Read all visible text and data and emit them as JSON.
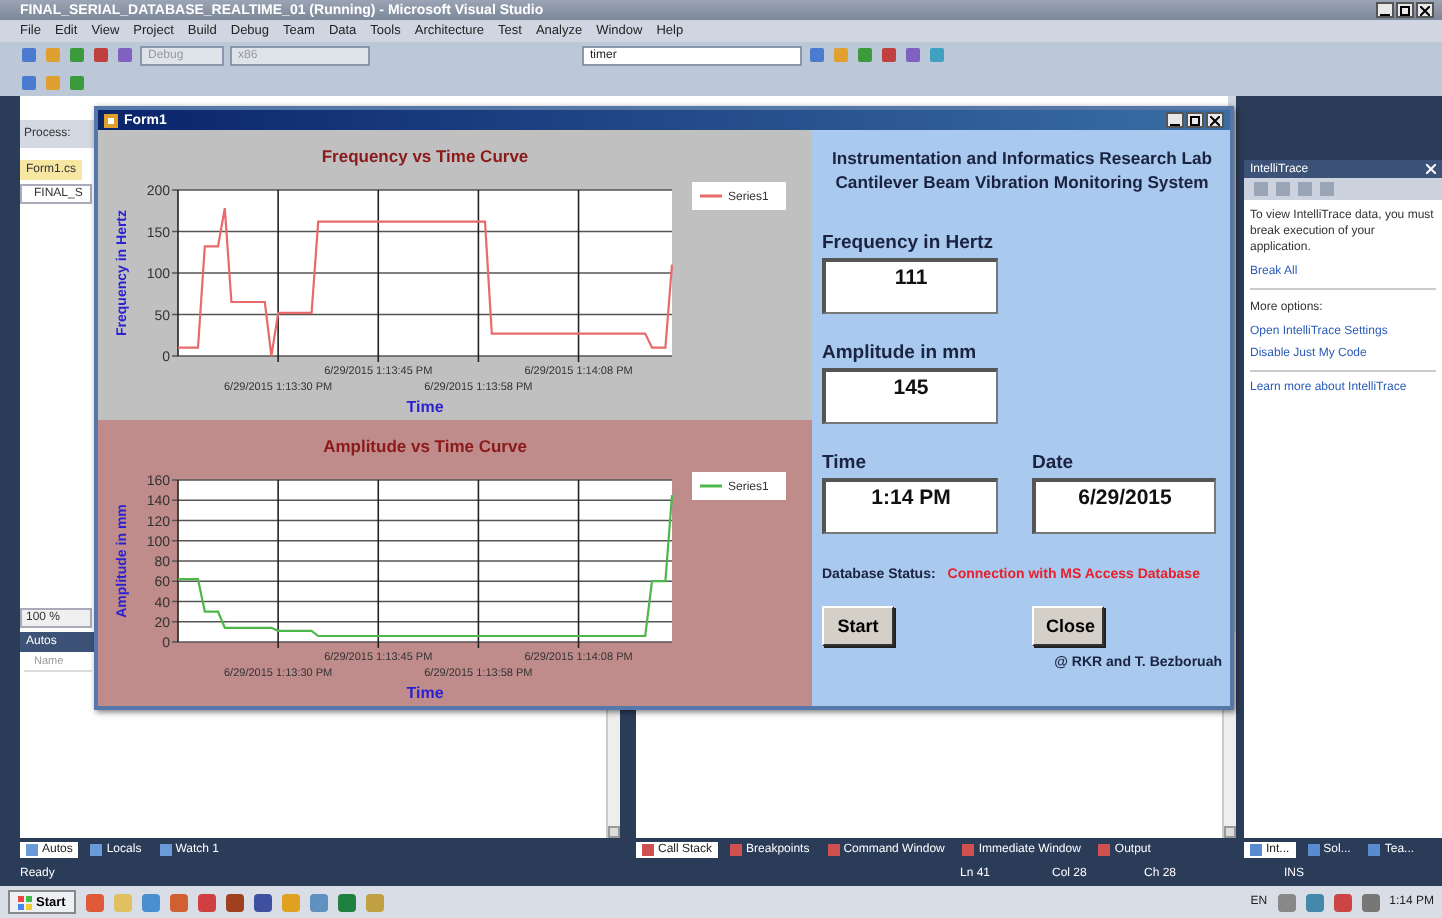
{
  "window": {
    "title": "FINAL_SERIAL_DATABASE_REALTIME_01 (Running) - Microsoft Visual Studio"
  },
  "menu": [
    "File",
    "Edit",
    "View",
    "Project",
    "Build",
    "Debug",
    "Team",
    "Data",
    "Tools",
    "Architecture",
    "Test",
    "Analyze",
    "Window",
    "Help"
  ],
  "toolbar": {
    "configuration": "Debug",
    "platform": "x86",
    "find": "timer"
  },
  "left_panel": {
    "toolbar_text": "Process:",
    "document_tab": "Form1.cs",
    "class_item": "FINAL_S",
    "zoom": "100 %",
    "autos_title": "Autos",
    "column": "Name"
  },
  "form": {
    "title": "Form1",
    "charts": [
      {
        "chart_data": {
          "type": "line",
          "grid": true,
          "title": "Frequency vs Time Curve",
          "xlabel": "Time",
          "ylabel": "Frequency in Hertz",
          "ylim": [
            0,
            200
          ],
          "yticks": [
            0,
            50,
            100,
            150,
            200
          ],
          "categories": [
            null,
            null,
            null,
            null,
            null,
            null,
            null,
            null,
            null,
            null,
            null,
            null,
            null,
            null,
            null,
            "6/29/2015 1:13:30 PM",
            null,
            null,
            null,
            null,
            null,
            null,
            null,
            null,
            null,
            null,
            null,
            null,
            null,
            null,
            "6/29/2015 1:13:45 PM",
            null,
            null,
            null,
            null,
            null,
            null,
            null,
            null,
            null,
            null,
            null,
            null,
            null,
            null,
            "6/29/2015 1:13:58 PM",
            null,
            null,
            null,
            null,
            null,
            null,
            null,
            null,
            null,
            null,
            null,
            null,
            null,
            null,
            "6/29/2015 1:14:08 PM",
            null,
            null,
            null,
            null,
            null,
            null,
            null,
            null,
            null,
            null,
            null,
            null,
            null,
            null
          ],
          "series": [
            {
              "name": "Series1",
              "color": "#e86a6a",
              "values": [
                10,
                10,
                10,
                10,
                132,
                132,
                132,
                178,
                65,
                65,
                65,
                65,
                65,
                65,
                0,
                52,
                52,
                52,
                52,
                52,
                52,
                162,
                162,
                162,
                162,
                162,
                162,
                162,
                162,
                162,
                162,
                162,
                162,
                162,
                162,
                162,
                162,
                162,
                162,
                162,
                162,
                162,
                162,
                162,
                162,
                162,
                162,
                27,
                27,
                27,
                27,
                27,
                27,
                27,
                27,
                27,
                27,
                27,
                27,
                27,
                27,
                27,
                27,
                27,
                27,
                27,
                27,
                27,
                27,
                27,
                27,
                10,
                10,
                10,
                110
              ]
            }
          ]
        }
      },
      {
        "chart_data": {
          "type": "line",
          "grid": true,
          "title": "Amplitude vs Time Curve",
          "xlabel": "Time",
          "ylabel": "Amplitude in mm",
          "ylim": [
            0,
            160
          ],
          "yticks": [
            0,
            20,
            40,
            60,
            80,
            100,
            120,
            140,
            160
          ],
          "categories": [
            null,
            null,
            null,
            null,
            null,
            null,
            null,
            null,
            null,
            null,
            null,
            null,
            null,
            null,
            null,
            "6/29/2015 1:13:30 PM",
            null,
            null,
            null,
            null,
            null,
            null,
            null,
            null,
            null,
            null,
            null,
            null,
            null,
            null,
            "6/29/2015 1:13:45 PM",
            null,
            null,
            null,
            null,
            null,
            null,
            null,
            null,
            null,
            null,
            null,
            null,
            null,
            null,
            "6/29/2015 1:13:58 PM",
            null,
            null,
            null,
            null,
            null,
            null,
            null,
            null,
            null,
            null,
            null,
            null,
            null,
            null,
            "6/29/2015 1:14:08 PM",
            null,
            null,
            null,
            null,
            null,
            null,
            null,
            null,
            null,
            null,
            null,
            null,
            null,
            null
          ],
          "series": [
            {
              "name": "Series1",
              "color": "#4cb84c",
              "values": [
                62,
                62,
                62,
                62,
                30,
                30,
                30,
                14,
                14,
                14,
                14,
                14,
                14,
                14,
                14,
                11,
                11,
                11,
                11,
                11,
                11,
                6,
                6,
                6,
                6,
                6,
                6,
                6,
                6,
                6,
                6,
                6,
                6,
                6,
                6,
                6,
                6,
                6,
                6,
                6,
                6,
                6,
                6,
                6,
                6,
                6,
                6,
                6,
                6,
                6,
                6,
                6,
                6,
                6,
                6,
                6,
                6,
                6,
                6,
                6,
                6,
                6,
                6,
                6,
                6,
                6,
                6,
                6,
                6,
                6,
                6,
                60,
                60,
                60,
                145
              ]
            }
          ]
        }
      }
    ],
    "heading": [
      "Instrumentation and Informatics Research Lab",
      "Cantilever Beam Vibration Monitoring System"
    ],
    "readouts": [
      {
        "label": "Frequency in Hertz",
        "value": "111"
      },
      {
        "label": "Amplitude in  mm",
        "value": "145"
      },
      {
        "label": "Time",
        "value": "1:14 PM"
      },
      {
        "label": "Date",
        "value": "6/29/2015"
      }
    ],
    "status": {
      "label": "Database Status:",
      "message": "Connection with MS Access Database"
    },
    "buttons": [
      "Start",
      "Close"
    ],
    "credit": "@ RKR and T. Bezboruah"
  },
  "intellitrace": {
    "title": "IntelliTrace",
    "message": "To view IntelliTrace data, you must break execution of your application.",
    "break_link": "Break All",
    "options_label": "More options:",
    "links": [
      "Open IntelliTrace Settings",
      "Disable Just My Code"
    ],
    "learn_link": "Learn more about IntelliTrace"
  },
  "tabs_left": [
    {
      "label": "Autos",
      "selected": true
    },
    {
      "label": "Locals",
      "selected": false
    },
    {
      "label": "Watch 1",
      "selected": false
    }
  ],
  "tabs_center": [
    {
      "label": "Call Stack",
      "selected": true
    },
    {
      "label": "Breakpoints",
      "selected": false
    },
    {
      "label": "Command Window",
      "selected": false
    },
    {
      "label": "Immediate Window",
      "selected": false
    },
    {
      "label": "Output",
      "selected": false
    }
  ],
  "tabs_right": [
    {
      "label": "Int...",
      "selected": true
    },
    {
      "label": "Sol...",
      "selected": false
    },
    {
      "label": "Tea...",
      "selected": false
    }
  ],
  "status_bar": {
    "text": "Ready",
    "ln": "Ln 41",
    "col": "Col 28",
    "ch": "Ch 28",
    "mode": "INS"
  },
  "taskbar": {
    "start": "Start",
    "language": "EN",
    "clock": "1:14 PM"
  }
}
